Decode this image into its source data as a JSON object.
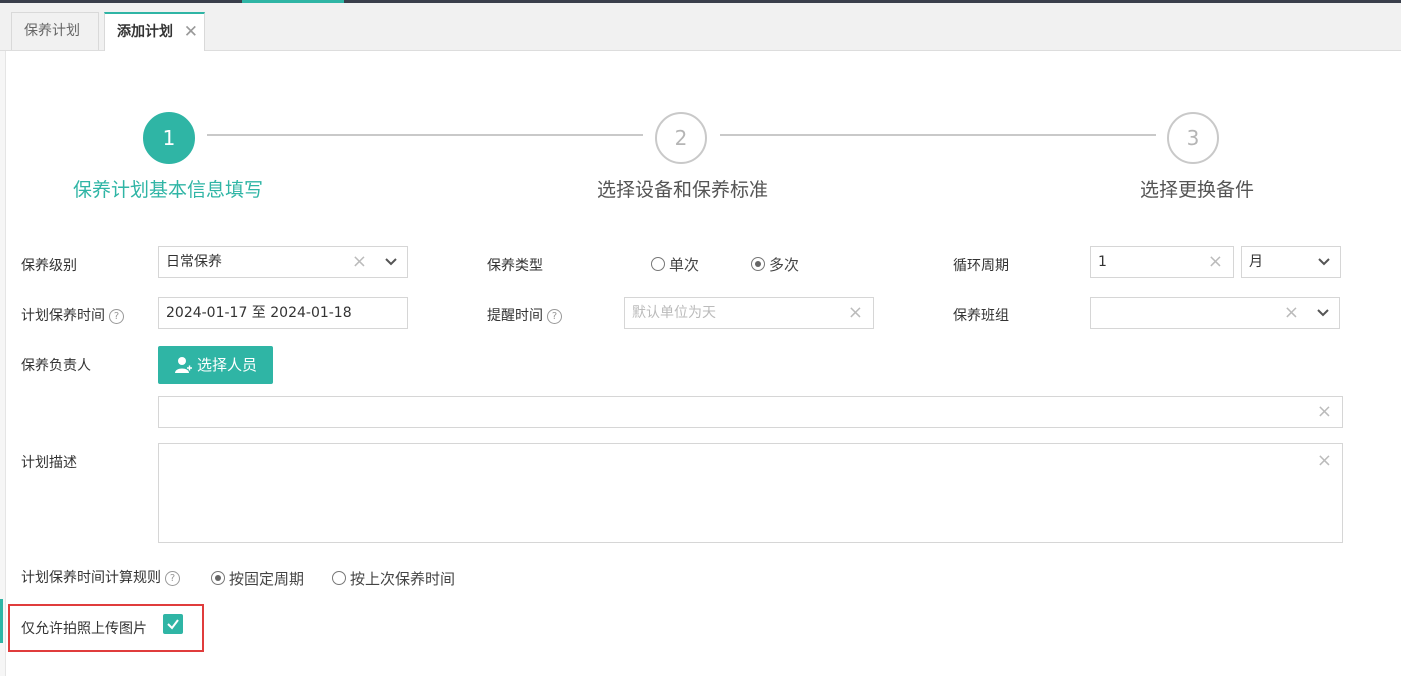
{
  "tabs": [
    {
      "label": "保养计划"
    },
    {
      "label": "添加计划",
      "close": "✕"
    }
  ],
  "steps": [
    {
      "num": "1",
      "label": "保养计划基本信息填写"
    },
    {
      "num": "2",
      "label": "选择设备和保养标准"
    },
    {
      "num": "3",
      "label": "选择更换备件"
    }
  ],
  "form": {
    "level": {
      "label": "保养级别",
      "value": "日常保养"
    },
    "type": {
      "label": "保养类型",
      "options": [
        "单次",
        "多次"
      ],
      "selected": "多次"
    },
    "cycle": {
      "label": "循环周期",
      "value": "1",
      "unit": "月"
    },
    "plan_time": {
      "label": "计划保养时间",
      "value": "2024-01-17 至 2024-01-18"
    },
    "remind": {
      "label": "提醒时间",
      "placeholder": "默认单位为天"
    },
    "team": {
      "label": "保养班组",
      "value": ""
    },
    "owner": {
      "label": "保养负责人",
      "button": "选择人员",
      "value": ""
    },
    "desc": {
      "label": "计划描述",
      "value": ""
    },
    "rule": {
      "label": "计划保养时间计算规则",
      "options": [
        "按固定周期",
        "按上次保养时间"
      ],
      "selected": "按固定周期"
    },
    "photo_only": {
      "label": "仅允许拍照上传图片",
      "checked": true
    }
  },
  "icons": {
    "help": "?",
    "clear": "×"
  },
  "colors": {
    "accent": "#2fb5a5",
    "highlight": "#e03c3c"
  }
}
